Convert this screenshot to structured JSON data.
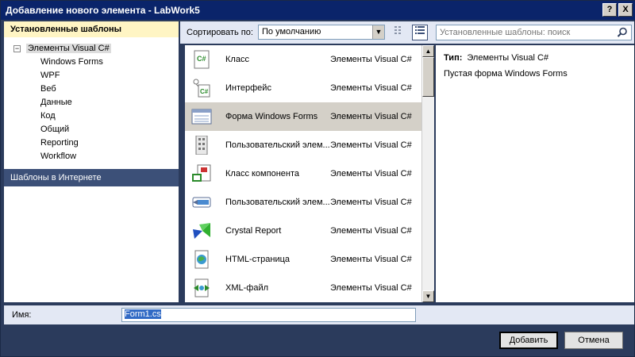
{
  "window": {
    "title": "Добавление нового элемента - LabWork5",
    "help_btn": "?",
    "close_btn": "X"
  },
  "left": {
    "installed_header": "Установленные шаблоны",
    "tree_root": "Элементы Visual C#",
    "tree_expander": "−",
    "tree_children": [
      "Windows Forms",
      "WPF",
      "Веб",
      "Данные",
      "Код",
      "Общий",
      "Reporting",
      "Workflow"
    ],
    "online_header": "Шаблоны в Интернете"
  },
  "toolbar": {
    "sort_label": "Сортировать по:",
    "sort_value": "По умолчанию",
    "search_placeholder": "Установленные шаблоны: поиск"
  },
  "templates": [
    {
      "name": "Класс",
      "category": "Элементы Visual C#",
      "icon": "csharp-class-icon"
    },
    {
      "name": "Интерфейс",
      "category": "Элементы Visual C#",
      "icon": "csharp-interface-icon"
    },
    {
      "name": "Форма Windows Forms",
      "category": "Элементы Visual C#",
      "icon": "windows-form-icon",
      "selected": true
    },
    {
      "name": "Пользовательский элем...",
      "category": "Элементы Visual C#",
      "icon": "user-control-icon"
    },
    {
      "name": "Класс компонента",
      "category": "Элементы Visual C#",
      "icon": "component-class-icon"
    },
    {
      "name": "Пользовательский элем...",
      "category": "Элементы Visual C#",
      "icon": "custom-control-icon"
    },
    {
      "name": "Crystal Report",
      "category": "Элементы Visual C#",
      "icon": "crystal-report-icon"
    },
    {
      "name": "HTML-страница",
      "category": "Элементы Visual C#",
      "icon": "html-page-icon"
    },
    {
      "name": "XML-файл",
      "category": "Элементы Visual C#",
      "icon": "xml-file-icon"
    }
  ],
  "details": {
    "type_label": "Тип:",
    "type_value": "Элементы Visual C#",
    "description": "Пустая форма Windows Forms"
  },
  "name_field": {
    "label": "Имя:",
    "value": "Form1.cs"
  },
  "buttons": {
    "add": "Добавить",
    "cancel": "Отмена"
  }
}
